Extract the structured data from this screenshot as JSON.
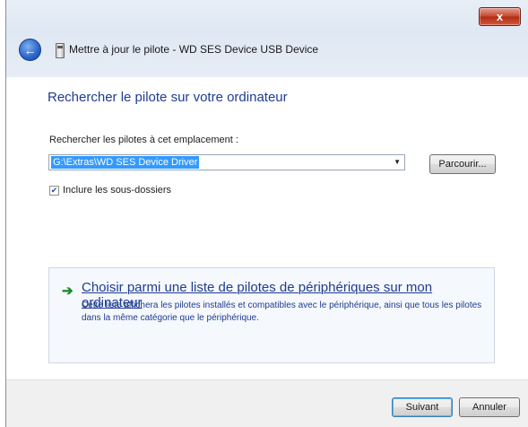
{
  "window": {
    "title": "Mettre à jour le pilote - WD SES Device USB Device",
    "close_label": "x"
  },
  "page": {
    "heading": "Rechercher le pilote sur votre ordinateur",
    "location_label": "Rechercher les pilotes à cet emplacement :",
    "path_value": "G:\\Extras\\WD SES Device Driver",
    "browse_button": "Parcourir...",
    "include_subfolders_label": "Inclure les sous-dossiers",
    "include_subfolders_checked": true,
    "option": {
      "title": "Choisir parmi une liste de pilotes de périphériques sur mon ordinateur",
      "description": "Cette liste affichera les pilotes installés et compatibles avec le périphérique, ainsi que tous les pilotes dans la même catégorie que le périphérique."
    }
  },
  "footer": {
    "next_button": "Suivant",
    "cancel_button": "Annuler"
  },
  "icons": {
    "back": "back-arrow-icon",
    "device": "usb-device-icon",
    "option": "green-arrow-icon",
    "dropdown": "dropdown-arrow-icon",
    "check": "checkmark-icon"
  },
  "colors": {
    "heading_blue": "#1f3c91",
    "selection_blue": "#3399ff",
    "close_red": "#c4442d",
    "link_arrow_green": "#1e8a2a"
  }
}
